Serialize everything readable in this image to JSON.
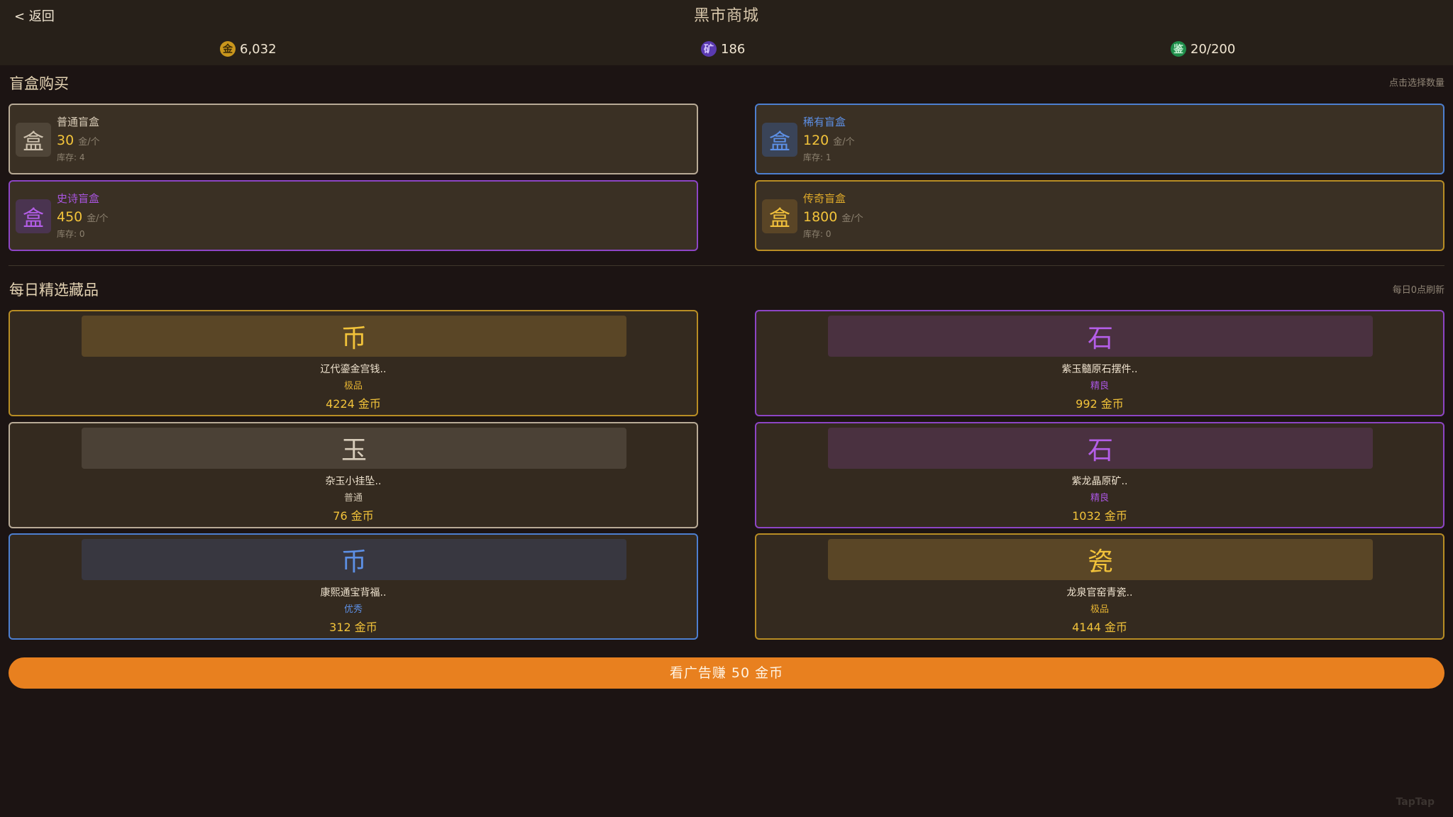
{
  "header": {
    "back_label": "< 返回",
    "title": "黑市商城"
  },
  "currencies": [
    {
      "icon_char": "金",
      "icon_name": "gold-coin-icon",
      "value": "6,032",
      "icon_bg": "#c9961d",
      "icon_fg": "#3a2a07"
    },
    {
      "icon_char": "矿",
      "icon_name": "ore-icon",
      "value": "186",
      "icon_bg": "#5a3ab0",
      "icon_fg": "#d7c8ff"
    },
    {
      "icon_char": "鉴",
      "icon_name": "appraise-icon",
      "value": "20/200",
      "icon_bg": "#1f8d4a",
      "icon_fg": "#c9f3d7"
    }
  ],
  "blindbox_section": {
    "title": "盲盒购买",
    "hint": "点击选择数量",
    "boxes": [
      {
        "icon_char": "盒",
        "name": "普通盲盒",
        "price": "30",
        "unit": "金/个",
        "stock": "库存: 4",
        "name_color": "#d8cbb6",
        "border": "#b8aa96",
        "icon_bg": "#4f4538",
        "icon_fg": "#cfc3b0"
      },
      {
        "icon_char": "盒",
        "name": "稀有盲盒",
        "price": "120",
        "unit": "金/个",
        "stock": "库存: 1",
        "name_color": "#5d90e6",
        "border": "#4d7fd0",
        "icon_bg": "#3a4458",
        "icon_fg": "#5d90e6"
      },
      {
        "icon_char": "盒",
        "name": "史诗盲盒",
        "price": "450",
        "unit": "金/个",
        "stock": "库存: 0",
        "name_color": "#a955e0",
        "border": "#8d45c5",
        "icon_bg": "#4a3450",
        "icon_fg": "#b45ee8"
      },
      {
        "icon_char": "盒",
        "name": "传奇盲盒",
        "price": "1800",
        "unit": "金/个",
        "stock": "库存: 0",
        "name_color": "#e0ab2a",
        "border": "#b88d24",
        "icon_bg": "#5a4526",
        "icon_fg": "#f0c03c"
      }
    ]
  },
  "daily_section": {
    "title": "每日精选藏品",
    "hint": "每日0点刷新",
    "items": [
      {
        "icon_char": "币",
        "name": "辽代鎏金宫钱..",
        "grade": "极品",
        "price": "4224 金币",
        "grade_color": "#e5b332",
        "border": "#b88d24",
        "banner_bg": "#5a4626",
        "icon_fg": "#f2c33a"
      },
      {
        "icon_char": "石",
        "name": "紫玉髓原石摆件..",
        "grade": "精良",
        "price": "992 金币",
        "grade_color": "#a955e0",
        "border": "#8d45c5",
        "banner_bg": "#4a3140",
        "icon_fg": "#b45ee8"
      },
      {
        "icon_char": "玉",
        "name": "杂玉小挂坠..",
        "grade": "普通",
        "price": "76 金币",
        "grade_color": "#d0c4b0",
        "border": "#b8aa96",
        "banner_bg": "#4b4136",
        "icon_fg": "#d8cdbb"
      },
      {
        "icon_char": "石",
        "name": "紫龙晶原矿..",
        "grade": "精良",
        "price": "1032 金币",
        "grade_color": "#a955e0",
        "border": "#8d45c5",
        "banner_bg": "#4a3140",
        "icon_fg": "#b45ee8"
      },
      {
        "icon_char": "币",
        "name": "康熙通宝背福..",
        "grade": "优秀",
        "price": "312 金币",
        "grade_color": "#5d90e6",
        "border": "#4d7fd0",
        "banner_bg": "#383740",
        "icon_fg": "#5d90e6"
      },
      {
        "icon_char": "瓷",
        "name": "龙泉官窑青瓷..",
        "grade": "极品",
        "price": "4144 金币",
        "grade_color": "#e5b332",
        "border": "#b88d24",
        "banner_bg": "#5a4626",
        "icon_fg": "#f2c33a"
      }
    ]
  },
  "ad_button": {
    "label": "看广告赚 50 金币"
  },
  "watermark": "TapTap"
}
